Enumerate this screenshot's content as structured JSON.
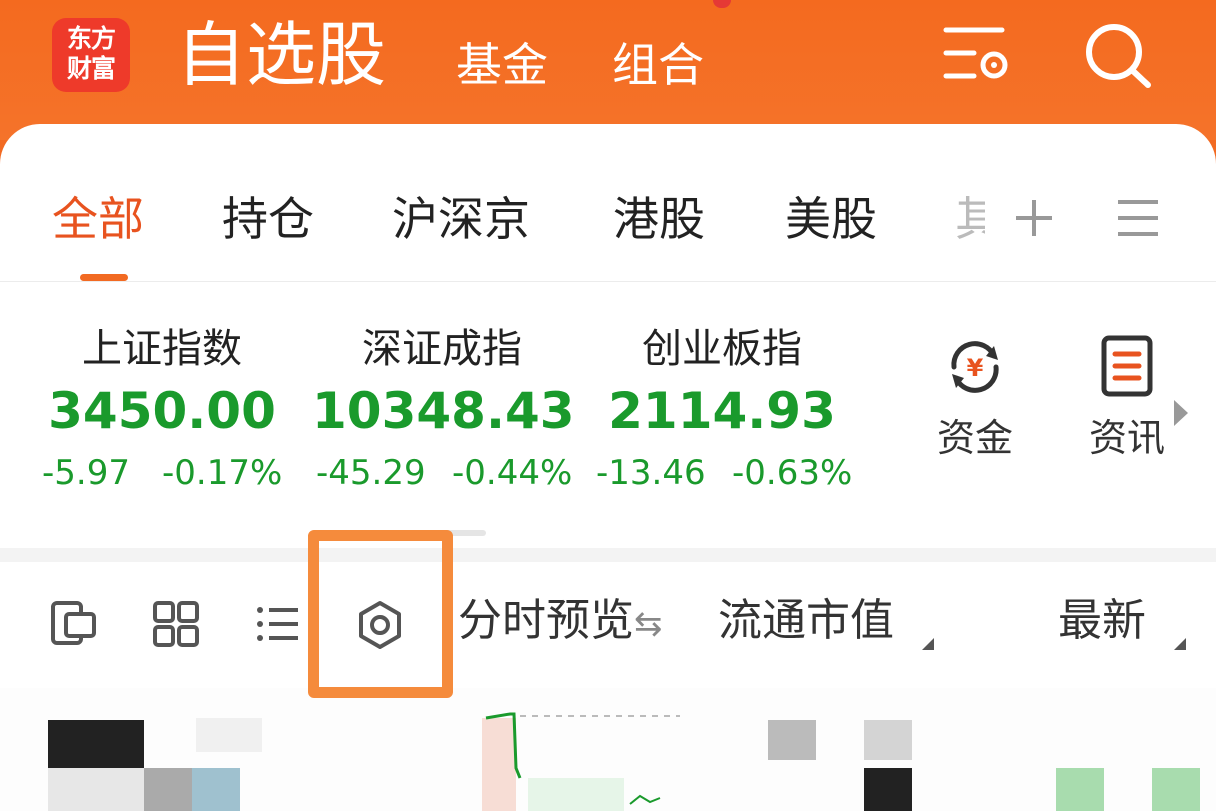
{
  "header": {
    "logo_line1": "东方",
    "logo_line2": "财富",
    "title": "自选股",
    "tabs": [
      "基金",
      "组合"
    ]
  },
  "category_tabs": {
    "items": [
      "全部",
      "持仓",
      "沪深京",
      "港股",
      "美股"
    ],
    "truncated": "其",
    "active_index": 0
  },
  "indices": [
    {
      "name": "上证指数",
      "value": "3450.00",
      "change": "-5.97",
      "pct": "-0.17%"
    },
    {
      "name": "深证成指",
      "value": "10348.43",
      "change": "-45.29",
      "pct": "-0.44%"
    },
    {
      "name": "创业板指",
      "value": "2114.93",
      "change": "-13.46",
      "pct": "-0.63%"
    }
  ],
  "quick_links": {
    "funds": "资金",
    "news": "资讯"
  },
  "toolbar": {
    "preview": "分时预览",
    "market_cap": "流通市值",
    "latest": "最新"
  },
  "colors": {
    "brand": "#f26a22",
    "down": "#1a9a2c",
    "active_tab": "#e8531f",
    "highlight": "#f58b3c"
  }
}
